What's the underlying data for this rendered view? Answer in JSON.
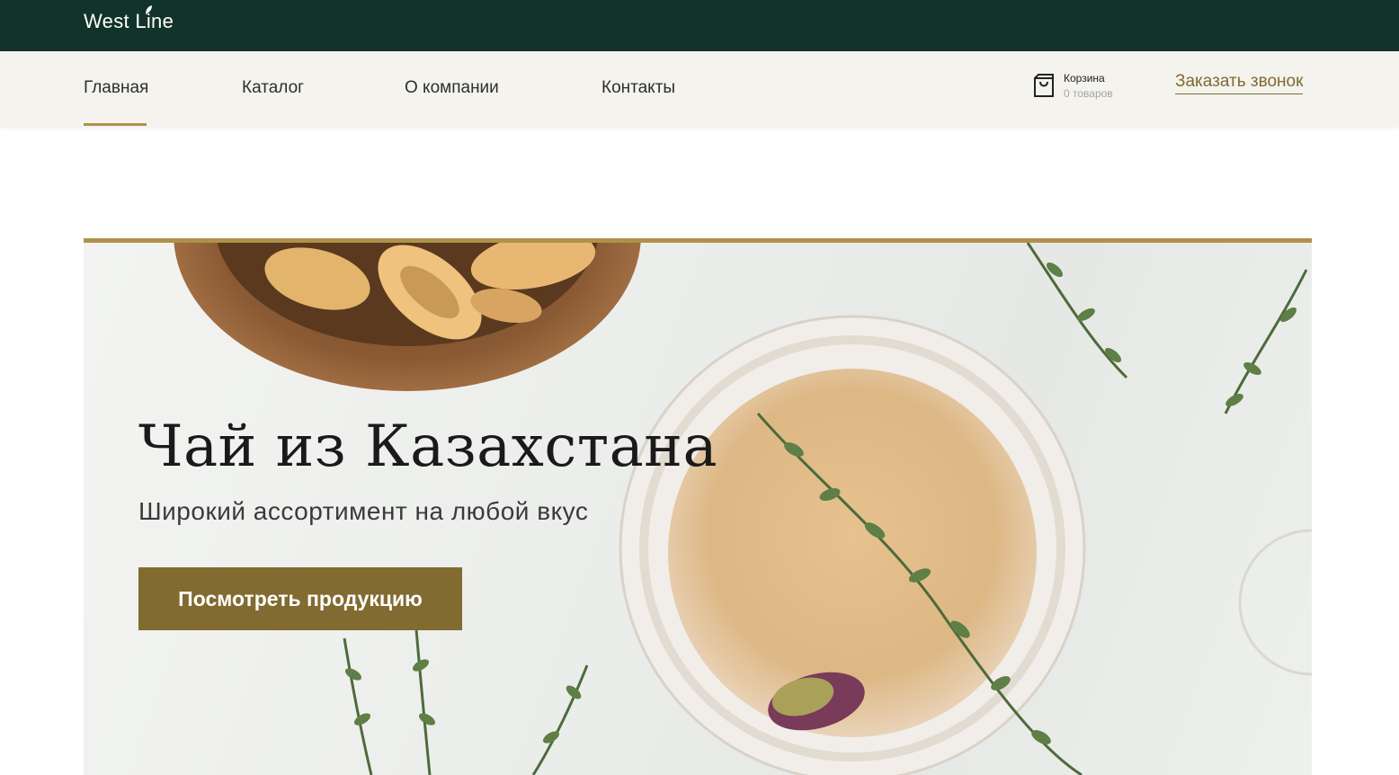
{
  "header": {
    "logo": "West Line"
  },
  "nav": {
    "items": [
      {
        "label": "Главная",
        "active": true
      },
      {
        "label": "Каталог",
        "active": false
      },
      {
        "label": "О компании",
        "active": false
      },
      {
        "label": "Контакты",
        "active": false
      }
    ],
    "cart": {
      "title": "Корзина",
      "count": "0 товаров"
    },
    "callback_label": "Заказать звонок"
  },
  "hero": {
    "title": "Чай из Казахстана",
    "subtitle": "Широкий ассортимент на любой вкус",
    "button_label": "Посмотреть продукцию"
  },
  "colors": {
    "topbar": "#12332a",
    "accent": "#b0914a",
    "button": "#816b30",
    "navbar": "#f4f3ee"
  },
  "icons": [
    "leaf-icon",
    "cart-bag-icon"
  ]
}
